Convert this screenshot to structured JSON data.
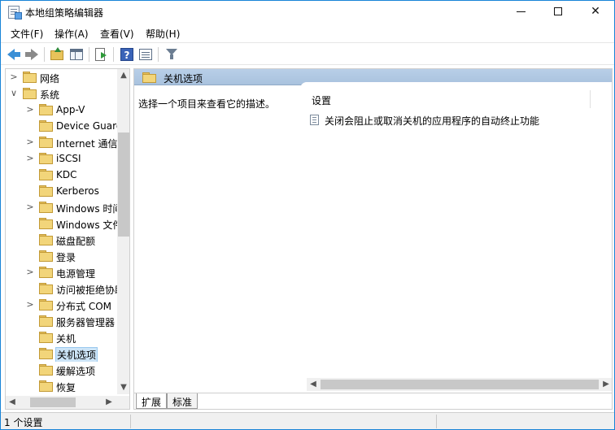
{
  "window": {
    "title": "本地组策略编辑器"
  },
  "menu": {
    "items": [
      "文件(F)",
      "操作(A)",
      "查看(V)",
      "帮助(H)"
    ]
  },
  "toolbar": {
    "buttons": [
      "back-icon",
      "forward-icon",
      "up-folder-icon",
      "show-hide-tree-icon",
      "export-list-icon",
      "help-icon",
      "properties-icon",
      "filter-icon"
    ]
  },
  "tree": {
    "items": [
      {
        "label": "网络",
        "chevron": ">"
      },
      {
        "label": "系统",
        "chevron": "∨"
      },
      {
        "label": "App-V",
        "chevron": ">"
      },
      {
        "label": "Device Guard",
        "chevron": ""
      },
      {
        "label": "Internet 通信管理",
        "chevron": ">"
      },
      {
        "label": "iSCSI",
        "chevron": ">"
      },
      {
        "label": "KDC",
        "chevron": ""
      },
      {
        "label": "Kerberos",
        "chevron": ""
      },
      {
        "label": "Windows 时间服务",
        "chevron": ">"
      },
      {
        "label": "Windows 文件保护",
        "chevron": ""
      },
      {
        "label": "磁盘配额",
        "chevron": ""
      },
      {
        "label": "登录",
        "chevron": ""
      },
      {
        "label": "电源管理",
        "chevron": ">"
      },
      {
        "label": "访问被拒绝协助",
        "chevron": ""
      },
      {
        "label": "分布式 COM",
        "chevron": ">"
      },
      {
        "label": "服务器管理器",
        "chevron": ""
      },
      {
        "label": "关机",
        "chevron": ""
      },
      {
        "label": "关机选项",
        "chevron": ""
      },
      {
        "label": "缓解选项",
        "chevron": ""
      },
      {
        "label": "恢复",
        "chevron": ""
      }
    ],
    "selected_label": "关机选项"
  },
  "right": {
    "header_title": "关机选项",
    "description": "选择一个项目来查看它的描述。",
    "column_header": "设置",
    "settings": [
      "关闭会阻止或取消关机的应用程序的自动终止功能"
    ]
  },
  "tabs": {
    "expand": "扩展",
    "standard": "标准"
  },
  "status": {
    "text": "1 个设置"
  }
}
